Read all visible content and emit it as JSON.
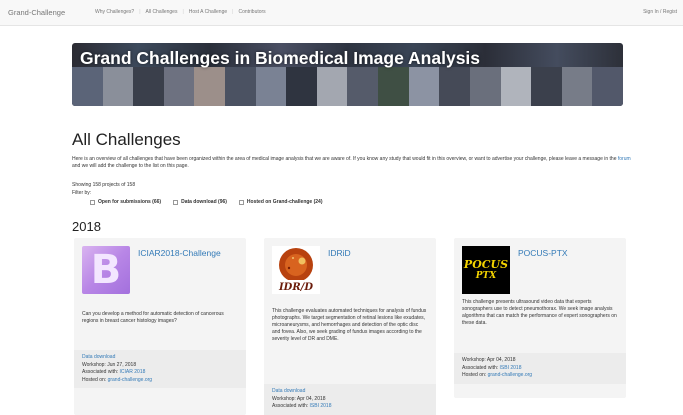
{
  "navbar": {
    "brand": "Grand-Challenge",
    "links": [
      "Why Challenges?",
      "All Challenges",
      "Host A Challenge",
      "Contributors"
    ],
    "sign_in": "Sign In / Regist"
  },
  "banner": {
    "title": "Grand Challenges in Biomedical Image Analysis"
  },
  "main": {
    "heading": "All Challenges",
    "intro_part1": "Here is an overview of all challenges that have been organized within the area of medical image analysis that we are aware of. If you know any study that would fit in this overview, or want to advertise your challenge, please leave a message in the ",
    "intro_link": "forum",
    "intro_part2": " and we will add the challenge to the list on this page.",
    "showing": "Showing 158 projects of 158",
    "filter_label": "Filter by:",
    "filters": [
      "Open for submissions (66)",
      "Data download (96)",
      "Hosted on Grand-challenge (24)"
    ],
    "year": "2018"
  },
  "cards": [
    {
      "title": "ICIAR2018-Challenge",
      "logo_letter": "B",
      "description": "Can you develop a method for automatic detection of cancerous regions in breast cancer histology images?",
      "data_download": "Data download",
      "workshop": "Workshop: Jun 27, 2018",
      "associated_label": "Associated with: ",
      "associated_value": "ICIAR 2018",
      "hosted_label": "Hosted on: ",
      "hosted_value": "grand-challenge.org"
    },
    {
      "title": "IDRiD",
      "logo_text": "IDR/D",
      "description": "This challenge evaluates automated techniques for analysis of fundus photographs. We target segmentation of retinal lesions like exudates, microaneurysms, and hemorrhages and detection of the optic disc and fovea. Also, we seek grading of fundus images according to the severity level of DR and DME.",
      "data_download": "Data download",
      "workshop": "Workshop: Apr 04, 2018",
      "associated_label": "Associated with: ",
      "associated_value": "ISBI 2018"
    },
    {
      "title": "POCUS-PTX",
      "logo_line1": "POCUS",
      "logo_line2": "PTX",
      "description": "This challenge presents ultrasound video data that experts sonographers use to detect pneumothorax. We seek image analysis algorithms that can match the performance of expert sonographers on these data.",
      "workshop": "Workshop: Apr 04, 2018",
      "associated_label": "Associated with: ",
      "associated_value": "ISBI 2018",
      "hosted_label": "Hosted on: ",
      "hosted_value": "grand-challenge.org"
    }
  ],
  "colors": {
    "link": "#337ab7",
    "navbar_bg": "#f8f8f8",
    "card_bg": "#f4f4f4",
    "pocus_yellow": "#f5d400",
    "iciar_purple": "#b886e6"
  }
}
